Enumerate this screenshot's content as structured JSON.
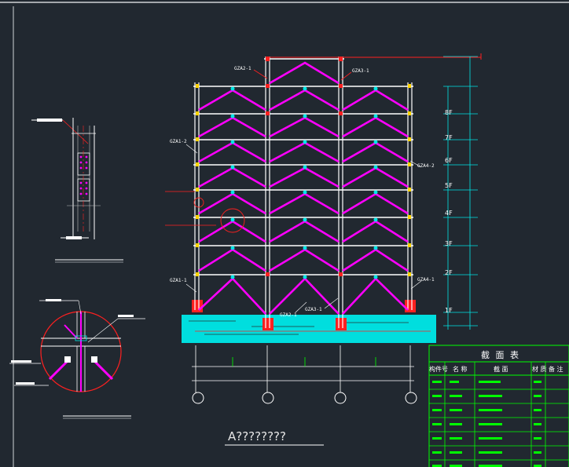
{
  "caption": "A????????",
  "member_labels": {
    "top_left": "GZA2-1",
    "top_right": "GZA3-1",
    "left_upper": "GZA1-2",
    "right_upper": "GZA4-2",
    "left_lower": "GZA1-1",
    "right_lower": "GZA4-1",
    "base_mid_left": "GZA2-1",
    "base_mid_right": "GZA3-1"
  },
  "levels": [
    "8F",
    "7F",
    "6F",
    "5F",
    "4F",
    "3F",
    "2F",
    "1F"
  ],
  "table": {
    "title": "截 面 表",
    "headers": [
      "构件号",
      "名 称",
      "截 面",
      "材 质",
      "备 注"
    ]
  },
  "colors": {
    "background": "#212830",
    "column": "#ffffff",
    "brace": "#ff00ff",
    "beam_red": "#ff2020",
    "foundation": "#00e5e5",
    "axis": "#ffffff",
    "table": "#00ff00",
    "level_marks": "#00e5e5"
  }
}
